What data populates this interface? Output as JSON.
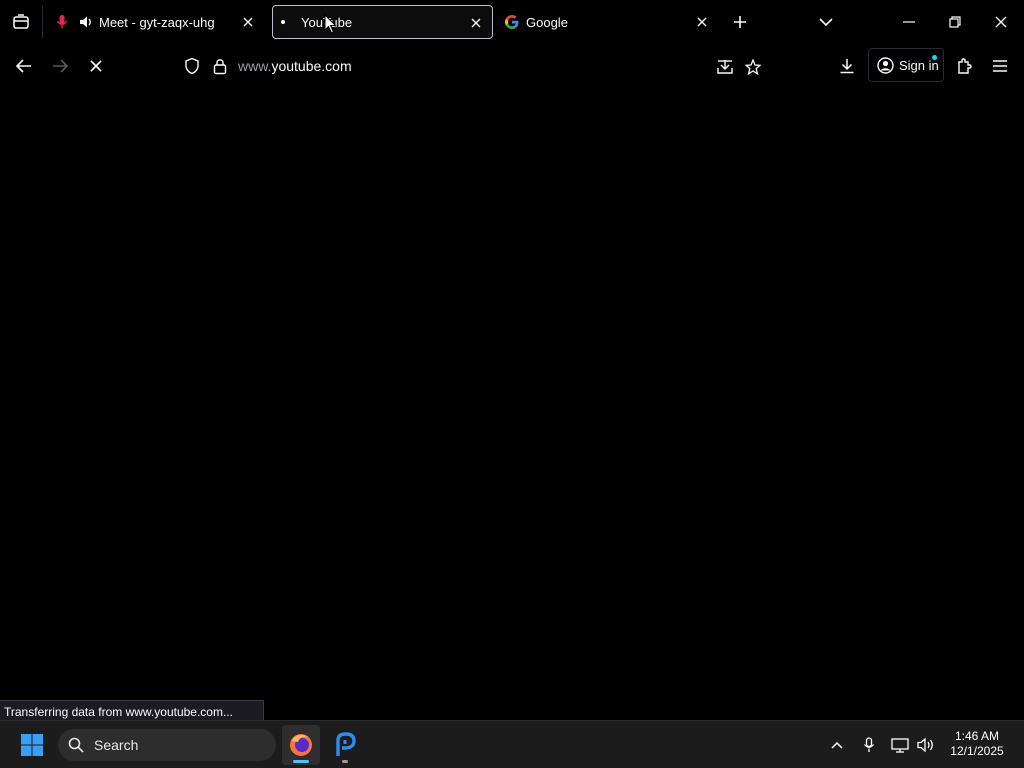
{
  "tabs": [
    {
      "title": "Meet - gyt-zaqx-uhg",
      "active": false,
      "icons": [
        "microphone-muted-icon",
        "speaker-icon"
      ]
    },
    {
      "title": "YouTube",
      "active": true,
      "loading": true
    },
    {
      "title": "Google",
      "active": false,
      "icons": [
        "google-g-icon"
      ]
    }
  ],
  "navbar": {
    "url_prefix": "www.",
    "url_domain": "youtube.com",
    "signin_label": "Sign in"
  },
  "status_text": "Transferring data from www.youtube.com...",
  "taskbar": {
    "search_label": "Search",
    "time": "1:46 AM",
    "date": "12/1/2025"
  },
  "colors": {
    "background": "#000000",
    "accent_blue": "#0a84ff",
    "mic_muted": "#e22850",
    "signin_dot": "#00ddff"
  }
}
